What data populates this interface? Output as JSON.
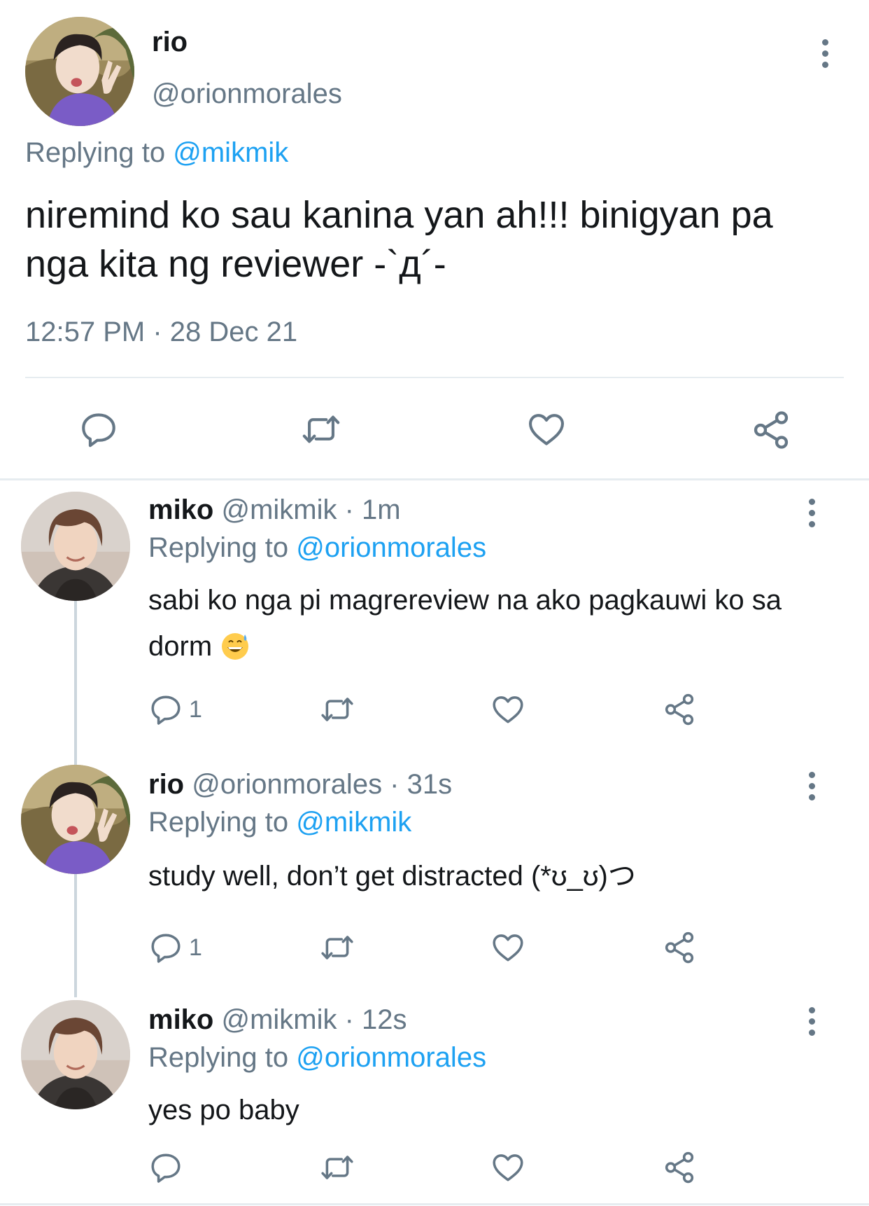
{
  "main_tweet": {
    "name": "rio",
    "handle": "@orionmorales",
    "replying_label": "Replying to",
    "replying_to": "@mikmik",
    "text": "niremind ko sau kanina yan ah!!! binigyan pa nga kita ng reviewer -`д´-",
    "timestamp": "12:57 PM · 28 Dec 21",
    "icons": [
      "reply-icon",
      "retweet-icon",
      "like-icon",
      "share-icon"
    ]
  },
  "replies": [
    {
      "name": "miko",
      "meta": "@mikmik · 1m",
      "replying_label": "Replying to",
      "replying_to": "@orionmorales",
      "text": "sabi ko nga pi magrereview na ako pagkauwi ko sa dorm",
      "emoji": "grinning-sweat-emoji",
      "reply_count": "1"
    },
    {
      "name": "rio",
      "meta": "@orionmorales · 31s",
      "replying_label": "Replying to",
      "replying_to": "@mikmik",
      "text": "study well, don’t get distracted (*ʊ_ʊ)つ",
      "reply_count": "1"
    },
    {
      "name": "miko",
      "meta": "@mikmik · 12s",
      "replying_label": "Replying to",
      "replying_to": "@orionmorales",
      "text": "yes po baby",
      "reply_count": ""
    }
  ],
  "colors": {
    "text": "#14171a",
    "secondary": "#657786",
    "link": "#1da1f2",
    "divider": "#e6ecf0",
    "thread_line": "#ccd6dd"
  }
}
